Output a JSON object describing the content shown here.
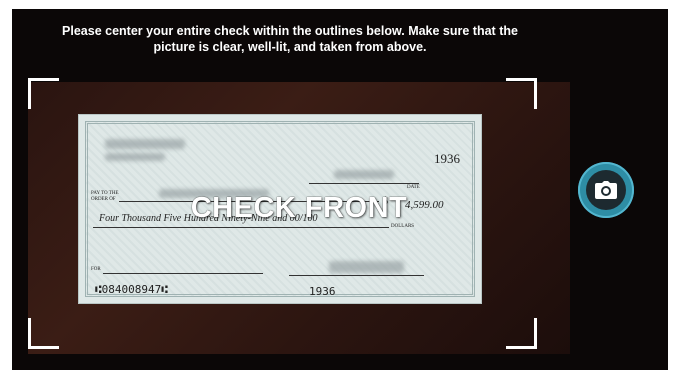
{
  "instructions": "Please center your entire check within the outlines below. Make sure that the\npicture is clear, well-lit, and taken from above.",
  "overlay_label": "CHECK FRONT",
  "check": {
    "number": "1936",
    "pay_to_the_order_of": "PAY TO THE\nORDER OF",
    "amount_words": "Four Thousand Five Hundred Ninety-Nine and 00/100",
    "amount_numeric": "4,599.00",
    "currency_symbol": "$",
    "dollars_label": "DOLLARS",
    "date_label": "DATE",
    "memo_label": "FOR",
    "routing": "⑆084008947⑆",
    "check_number_micr": "1936"
  },
  "capture_button": {
    "icon": "camera-icon",
    "color": "#2e8da5"
  }
}
